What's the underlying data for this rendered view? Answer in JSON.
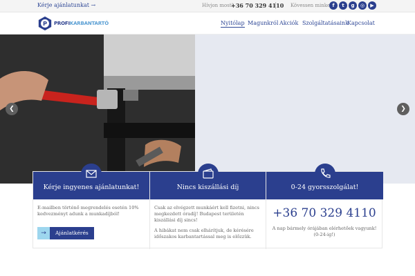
{
  "topbar": {
    "quote_link": "Kérje ajánlatunkat →",
    "call_label": "Hívjon most!",
    "call_number": "+36 70 329 4110",
    "follow_label": "Kövessen minket:",
    "social_icons": [
      "facebook-icon",
      "twitter-icon",
      "google-plus-icon",
      "instagram-icon",
      "youtube-icon"
    ]
  },
  "brand": {
    "logo_letter": "P",
    "name_bold": "PROFI",
    "name_light": "KARBANTARTÓ",
    "primary_color": "#2b3f8e",
    "accent_color": "#9dd6ee"
  },
  "nav": {
    "items": [
      {
        "label": "Nyitólap",
        "active": true
      },
      {
        "label": "Magunkról",
        "active": false
      },
      {
        "label": "Akciók",
        "active": false
      },
      {
        "label": "Szolgáltatásaink",
        "active": false
      },
      {
        "label": "Kapcsolat",
        "active": false
      }
    ]
  },
  "slider": {
    "prev_icon": "chevron-left-icon",
    "next_icon": "chevron-right-icon",
    "prev_glyph": "❮",
    "next_glyph": "❯"
  },
  "features": [
    {
      "icon": "envelope-icon",
      "title": "Kérje ingyenes ajánlatunkat!",
      "text": "E-mailben történő megrendelés esetén 10% kedvezményt adunk a munkadíjból!",
      "button": "Ajánlatkérés",
      "button_arrow": "→"
    },
    {
      "icon": "wallet-icon",
      "title": "Nincs kiszállási díj",
      "text": "Csak az elvégzett munkáért kell fizetni, nincs megkezdett óradíj! Budapest területén kiszállási díj sincs!",
      "text2": "A hibákat nem csak elhárítjuk, de kérésére időszakos karbantartással meg is előzzük."
    },
    {
      "icon": "phone-icon",
      "title": "0-24 gyorsszolgálat!",
      "phone": "+36 70 329 4110",
      "text": "A nap bármely órájában elérhetőek vagyunk! (0-24-ig!)"
    }
  ]
}
